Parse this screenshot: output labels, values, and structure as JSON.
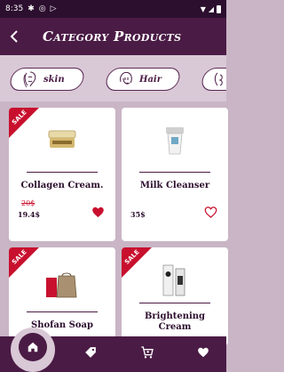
{
  "status_bar": {
    "time": "8:35"
  },
  "app_bar": {
    "title": "Category Products"
  },
  "categories": [
    {
      "label": "skin",
      "icon": "skin-face-icon"
    },
    {
      "label": "Hair",
      "icon": "hair-face-icon"
    },
    {
      "label": "",
      "icon": "partial-category-icon"
    }
  ],
  "products": [
    {
      "name": "Collagen Cream.",
      "sale_badge": "SALE",
      "old_price": "20$",
      "price": "19.4$",
      "favorite": true,
      "image": "cream-jar-image"
    },
    {
      "name": "Milk Cleanser",
      "sale_badge": "",
      "old_price": "",
      "price": "35$",
      "favorite": false,
      "image": "cleanser-tube-image"
    },
    {
      "name": "Shofan Soap",
      "sale_badge": "SALE",
      "old_price": "",
      "price": "",
      "favorite": false,
      "image": "soap-bag-image"
    },
    {
      "name": "Brightening Cream",
      "sale_badge": "SALE",
      "old_price": "",
      "price": "",
      "favorite": false,
      "image": "cream-box-image"
    }
  ],
  "bottom_nav": [
    {
      "name": "home",
      "icon": "home-icon",
      "active": true
    },
    {
      "name": "tags",
      "icon": "tag-icon",
      "active": false
    },
    {
      "name": "cart",
      "icon": "cart-icon",
      "active": false
    },
    {
      "name": "favorites",
      "icon": "heart-icon",
      "active": false
    }
  ],
  "colors": {
    "primary": "#4a1b45",
    "accent": "#c8102e",
    "background": "#c9b5c5"
  }
}
